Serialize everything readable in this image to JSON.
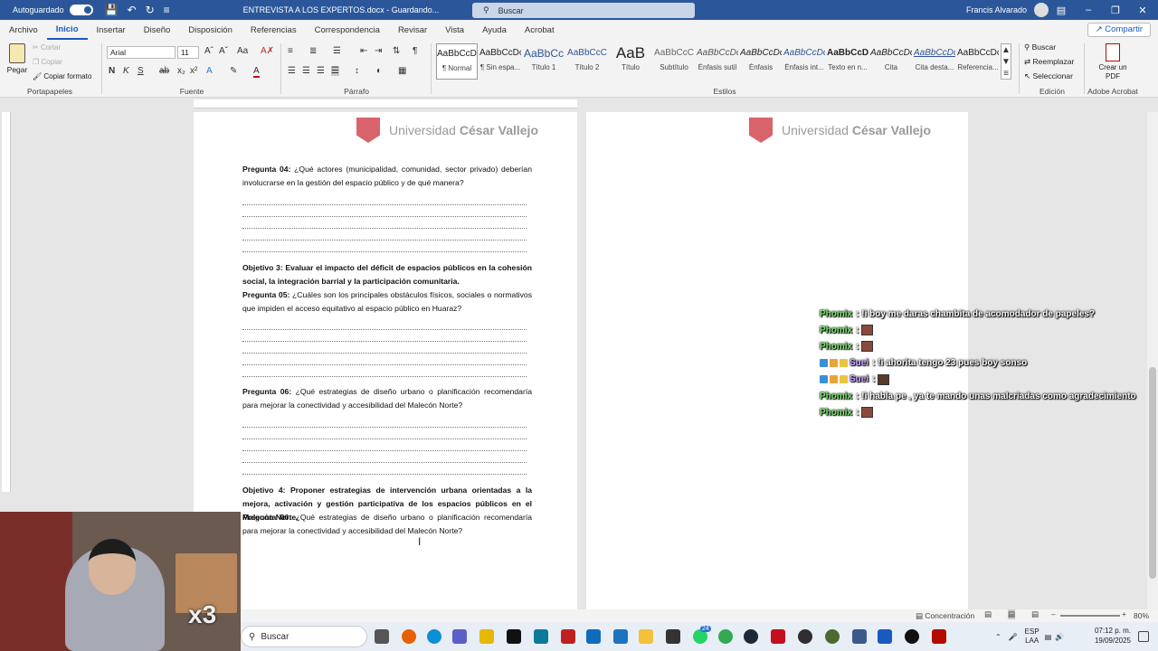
{
  "titlebar": {
    "autosave_label": "Autoguardado",
    "doc_title": "ENTREVISTA A LOS EXPERTOS.docx  -  Guardando...",
    "search_placeholder": "Buscar",
    "user_name": "Francis Alvarado"
  },
  "tabs": [
    "Archivo",
    "Inicio",
    "Insertar",
    "Diseño",
    "Disposición",
    "Referencias",
    "Correspondencia",
    "Revisar",
    "Vista",
    "Ayuda",
    "Acrobat"
  ],
  "share_label": "Compartir",
  "ribbon": {
    "clipboard": {
      "paste": "Pegar",
      "cut": "Cortar",
      "copy": "Copiar",
      "format_painter": "Copiar formato",
      "label": "Portapapeles"
    },
    "font": {
      "name": "Arial",
      "size": "11",
      "label": "Fuente"
    },
    "paragraph": {
      "label": "Párrafo"
    },
    "styles": {
      "label": "Estilos",
      "items": [
        {
          "preview": "AaBbCcDc",
          "name": "¶ Normal"
        },
        {
          "preview": "AaBbCcDc",
          "name": "¶ Sin espa..."
        },
        {
          "preview": "AaBbCc",
          "name": "Título 1"
        },
        {
          "preview": "AaBbCcC",
          "name": "Título 2"
        },
        {
          "preview": "AaB",
          "name": "Título"
        },
        {
          "preview": "AaBbCcC",
          "name": "Subtítulo"
        },
        {
          "preview": "AaBbCcDc",
          "name": "Énfasis sutil"
        },
        {
          "preview": "AaBbCcDc",
          "name": "Énfasis"
        },
        {
          "preview": "AaBbCcDc",
          "name": "Énfasis int..."
        },
        {
          "preview": "AaBbCcDc",
          "name": "Texto en n..."
        },
        {
          "preview": "AaBbCcDc",
          "name": "Cita"
        },
        {
          "preview": "AaBbCcDc",
          "name": "Cita desta..."
        },
        {
          "preview": "AaBbCcDc",
          "name": "Referencia..."
        }
      ]
    },
    "editing": {
      "find": "Buscar",
      "replace": "Reemplazar",
      "select": "Seleccionar",
      "label": "Edición"
    },
    "acrobat": {
      "create_pdf": "Crear un PDF",
      "label": "Adobe Acrobat"
    }
  },
  "page": {
    "logo_text_1": "Universidad ",
    "logo_text_2": "César Vallejo",
    "q4_label": "Pregunta 04:",
    "q4_text": " ¿Qué actores (municipalidad, comunidad, sector privado) deberían involucrarse en la gestión del espacio público y de qué manera?",
    "obj3": "Objetivo 3: Evaluar el impacto del déficit de espacios públicos en la cohesión social, la integración barrial y la participación comunitaria.",
    "q5_label": "Pregunta 05:",
    "q5_text": " ¿Cuáles son los principales obstáculos físicos, sociales o normativos que impiden el acceso equitativo al espacio público en Huaraz?",
    "q6_label": "Pregunta 06:",
    "q6_text": " ¿Qué estrategias de diseño urbano o planificación recomendaría para mejorar la conectividad y accesibilidad del Malecón Norte?",
    "obj4": "Objetivo 4: Proponer estrategias de intervención urbana orientadas a la mejora, activación y gestión participativa de los espacios públicos en el Malecón Norte.",
    "q6b_label": "Pregunta 06:",
    "q6b_text": " ¿Qué estrategias de diseño urbano o planificación recomendaría para mejorar la conectividad y accesibilidad del Malecón Norte?"
  },
  "chat": [
    {
      "user": "Phomix",
      "text": ": !i boy me daras chambita de acomodador de papeles?",
      "emote": false
    },
    {
      "user": "Phomix",
      "text": ":",
      "emote": true
    },
    {
      "user": "Phomix",
      "text": ":",
      "emote": true
    },
    {
      "user": "Suei",
      "text": ": !i ahorita tengo 23 pues boy sonso",
      "emote": false
    },
    {
      "user": "Suei",
      "text": ":",
      "emote": true
    },
    {
      "user": "Phomix",
      "text": ": !i habla pe , ya te mando unas malcriadas como agradecimiento",
      "emote": false
    },
    {
      "user": "Phomix",
      "text": ":",
      "emote": true
    }
  ],
  "status": {
    "focus": "Concentración",
    "zoom": "80%"
  },
  "overlay_text": "x3",
  "taskbar": {
    "search": "Buscar",
    "lang1": "ESP",
    "lang2": "LAA",
    "time": "07:12 p. m.",
    "date": "19/09/2025",
    "badge": "24"
  },
  "colors": {
    "word_blue": "#2b579a",
    "accent": "#185abd",
    "ucv_red": "#d9636b",
    "chat_green": "#7be36d"
  }
}
